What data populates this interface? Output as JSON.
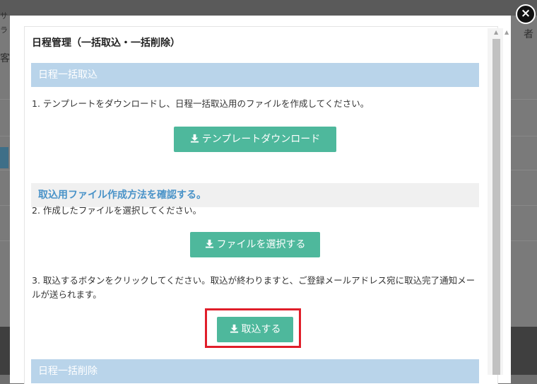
{
  "modal": {
    "title": "日程管理（一括取込・一括削除）",
    "import_section_title": "日程一括取込",
    "step1": "1.  テンプレートをダウンロードし、日程一括取込用のファイルを作成してください。",
    "download_template_label": "テンプレートダウンロード",
    "howto_link": "取込用ファイル作成方法を確認する。",
    "step2": "2.  作成したファイルを選択してください。",
    "select_file_label": "ファイルを選択する",
    "step3": "3.  取込するボタンをクリックしてください。取込が終わりますと、ご登録メールアドレス宛に取込完了通知メールが送られます。",
    "import_button_label": "取込する",
    "delete_section_title": "日程一括削除"
  },
  "background": {
    "text_fragments": [
      "サ",
      "ラ",
      "客",
      "者"
    ]
  },
  "colors": {
    "button_green": "#4eb89c",
    "section_blue": "#b9d4ea",
    "link_blue": "#4a93c8",
    "highlight_red": "#e01e2a"
  },
  "icons": {
    "close": "close-icon",
    "download": "download-icon"
  }
}
